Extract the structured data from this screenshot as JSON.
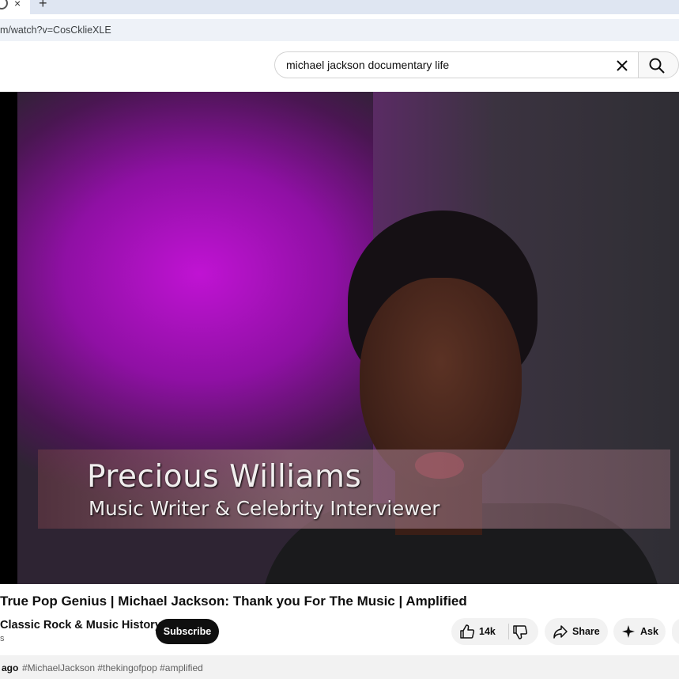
{
  "browser": {
    "tab_close_glyph": "×",
    "new_tab_glyph": "+",
    "url": "m/watch?v=CosCklieXLE"
  },
  "header": {
    "search_query": "michael jackson documentary life"
  },
  "video": {
    "caption_name": "Precious Williams",
    "caption_role": "Music Writer & Celebrity Interviewer"
  },
  "meta": {
    "title": "True Pop Genius | Michael Jackson: Thank you For The Music | Amplified",
    "channel": "Classic Rock & Music History",
    "subs_fragment": "s",
    "subscribe_label": "Subscribe",
    "like_count": "14k",
    "share_label": "Share",
    "ask_label": "Ask"
  },
  "description": {
    "time_fragment": "ago",
    "hashtags": "#MichaelJackson #thekingofpop #amplified"
  },
  "icons": {
    "tab": "favicon-icon",
    "clear": "close-icon",
    "search": "search-icon",
    "like": "thumbs-up-icon",
    "dislike": "thumbs-down-icon",
    "share": "share-arrow-icon",
    "ask": "sparkle-icon"
  }
}
